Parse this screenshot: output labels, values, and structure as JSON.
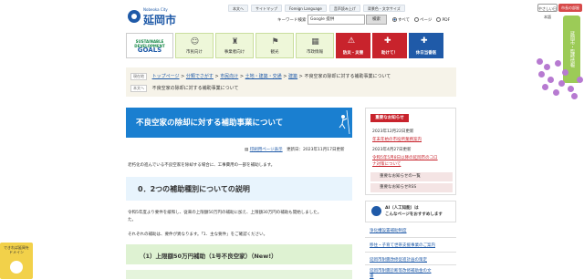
{
  "header": {
    "logo_sub": "Nobeoka City",
    "logo_name": "延岡市",
    "top_links": [
      "本文へ",
      "サイトマップ",
      "Foreign Language",
      "音声読み上げ",
      "文字サイズ",
      "背景色・文字サイズ"
    ],
    "btn_jp": "やさしい日本語",
    "btn_home": "市長の部屋",
    "keyword_label": "キーワード検索",
    "search_value": "Google 提供",
    "search_button": "検索",
    "radio_options": [
      "すべて",
      "ページ",
      "PDF"
    ]
  },
  "nav": {
    "sdgs_top": "SUSTAINABLE DEVELOPMENT",
    "sdgs_goals": "GOALS",
    "items": [
      "市民向け",
      "事業者向け",
      "観光",
      "市政情報"
    ],
    "red_items": [
      "防災・災害",
      "助けて！"
    ],
    "blue_item": "休日当番医"
  },
  "sidetab": "延岡市・臨時情報",
  "breadcrumb": {
    "tag1": "現在地",
    "links": [
      "トップページ",
      "分類でさがす",
      "市民向け",
      "土地・建築・交通",
      "建築"
    ],
    "current": "不良空家の除却に対する補助事業について",
    "tag2": "本文へ",
    "row2": "不良空家の除却に対する補助事業について"
  },
  "main": {
    "title": "不良空家の除却に対する補助事業について",
    "print_link": "印刷用ページ表示",
    "updated": "更新日：2023年11月17日更新",
    "intro": "老朽化の進んでいる不良空家を除却する場合に、工事費用の一部を補助します。",
    "h2": "0．2つの補助種別についての説明",
    "p1": "令和5年度より要件を緩和し、従来の上限額50万円の補助に加え、上限額30万円の補助も開始しました。",
    "p1b": "た。",
    "p2": "それぞれの補助は、要件が異なります。「1．主な要件」をご確認ください。",
    "h3": "（1）上限額50万円補助（1号不良空家）（New!）"
  },
  "notice": {
    "heading": "重要なお知らせ",
    "d1": "2023年12月22日更新",
    "l1": "年末年始の市役所業務案内",
    "d2": "2023年4月27日更新",
    "l2a": "令和5年5月8日以降の延岡市のコロ",
    "l2b": "ナ対策について",
    "more1": "重要なお知らせの一覧",
    "more2": "重要なお知らせRSS"
  },
  "ai": {
    "t1": "AI（人工知能）は",
    "t2": "こんなページをおすすめします"
  },
  "recommend": [
    "浄化槽設置補助制度",
    "移住・子育て世帯支援事業のご案内",
    "延岡市耐震改修促進計画の策定",
    "延岡市耐震診断等改修補助金の文",
    "書"
  ],
  "badge": {
    "line1": "できれば延岡を",
    "line2": "ドメイン"
  }
}
